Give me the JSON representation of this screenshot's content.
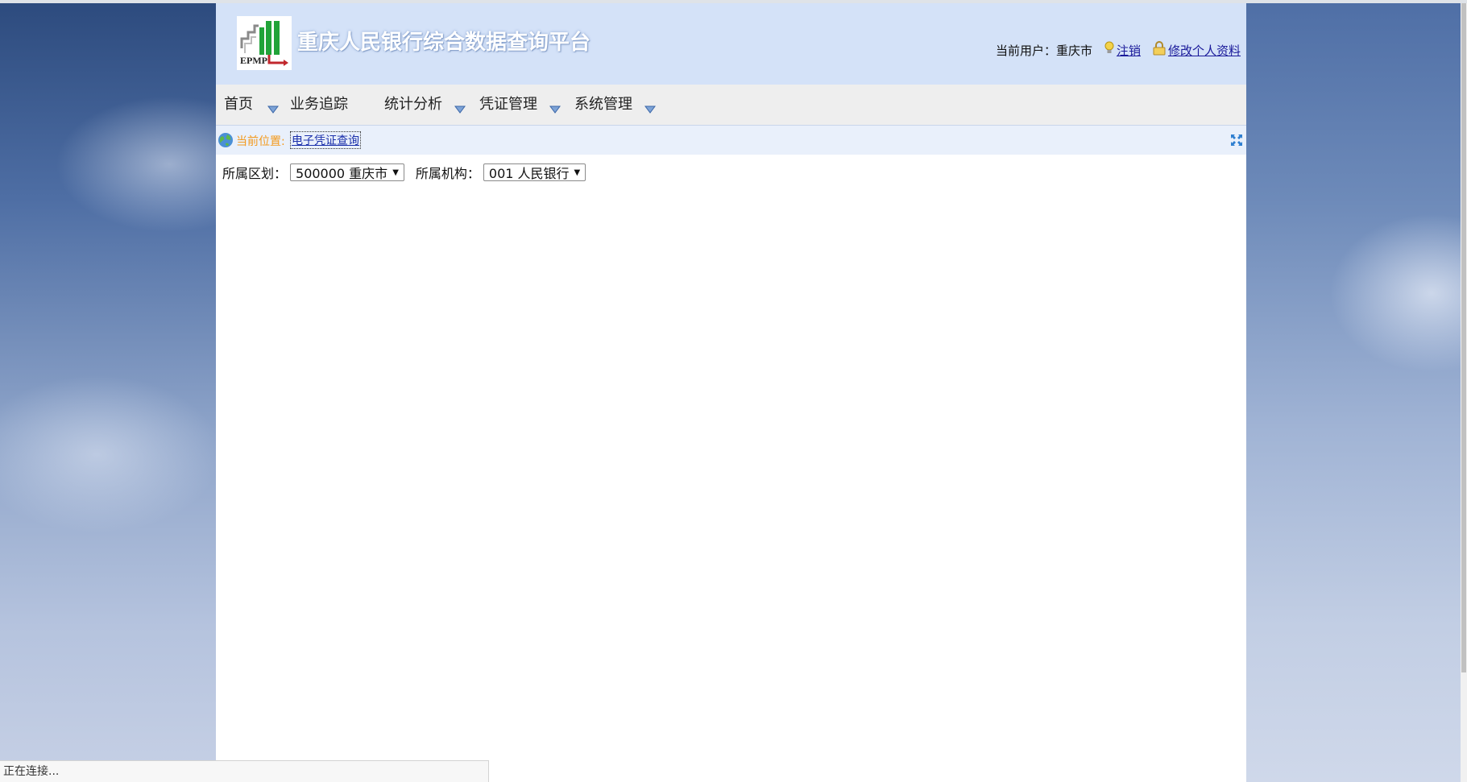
{
  "header": {
    "logo_text": "EPMP",
    "title": "重庆人民银行综合数据查询平台",
    "user_label": "当前用户：",
    "user_name": "重庆市",
    "logout_label": "注销",
    "edit_profile_label": "修改个人资料"
  },
  "menu": {
    "items": [
      {
        "label": "首页",
        "icon": "chevron-down-icon"
      },
      {
        "label": "业务追踪"
      },
      {
        "label": "统计分析",
        "icon": "chevron-down-icon"
      },
      {
        "label": "凭证管理",
        "icon": "chevron-down-icon"
      },
      {
        "label": "系统管理",
        "icon": "chevron-down-icon"
      }
    ]
  },
  "breadcrumb": {
    "label": "当前位置:",
    "current": "电子凭证查询"
  },
  "filters": {
    "region_label": "所属区划：",
    "region_value": "500000 重庆市",
    "org_label": "所属机构：",
    "org_value": "001 人民银行"
  },
  "status_bar": {
    "text": "正在连接..."
  },
  "colors": {
    "header_bg": "#d4e2f8",
    "menu_bg": "#eeeeee",
    "breadcrumb_label": "#f39a1e",
    "link": "#1a2faa"
  }
}
